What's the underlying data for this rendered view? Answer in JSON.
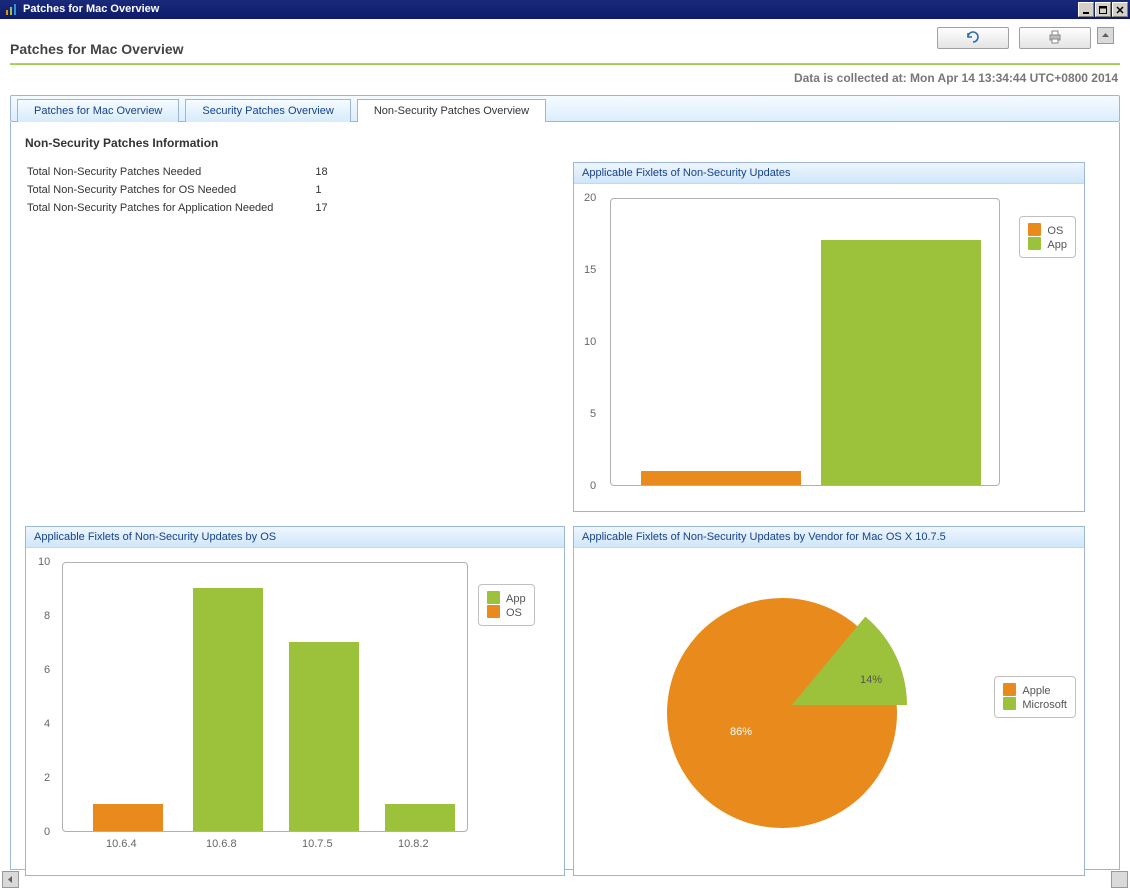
{
  "colors": {
    "orange": "#e98b1c",
    "green": "#9cc13b",
    "panel_blue": "#d0e6fb",
    "blue_text": "#15428b"
  },
  "window_title": "Patches for Mac Overview",
  "page_title": "Patches for Mac Overview",
  "data_collected_label": "Data is collected at: Mon Apr 14 13:34:44 UTC+0800 2014",
  "tabs": [
    {
      "label": "Patches for Mac Overview"
    },
    {
      "label": "Security Patches Overview"
    },
    {
      "label": "Non-Security Patches Overview"
    }
  ],
  "section_title": "Non-Security Patches Information",
  "info_rows": [
    {
      "label": "Total Non-Security Patches Needed",
      "value": "18"
    },
    {
      "label": "Total Non-Security Patches for OS Needed",
      "value": "1"
    },
    {
      "label": "Total Non-Security Patches for Application Needed",
      "value": "17"
    }
  ],
  "panel1": {
    "title": "Applicable Fixlets of Non-Security Updates",
    "legend": [
      {
        "name": "OS",
        "color": "#e98b1c"
      },
      {
        "name": "App",
        "color": "#9cc13b"
      }
    ]
  },
  "panel2": {
    "title": "Applicable Fixlets of Non-Security Updates by OS",
    "legend": [
      {
        "name": "App",
        "color": "#9cc13b"
      },
      {
        "name": "OS",
        "color": "#e98b1c"
      }
    ]
  },
  "panel3": {
    "title": "Applicable Fixlets of Non-Security Updates by Vendor for Mac OS X 10.7.5",
    "legend": [
      {
        "name": "Apple",
        "color": "#e98b1c"
      },
      {
        "name": "Microsoft",
        "color": "#9cc13b"
      }
    ],
    "slice1_label": "14%",
    "slice2_label": "86%"
  },
  "chart_data": [
    {
      "type": "bar",
      "title": "Applicable Fixlets of Non-Security Updates",
      "categories": [
        "",
        ""
      ],
      "series": [
        {
          "name": "OS",
          "values": [
            1,
            0
          ]
        },
        {
          "name": "App",
          "values": [
            0,
            17
          ]
        }
      ],
      "ylim": [
        0,
        20
      ],
      "yticks": [
        0,
        5,
        10,
        15,
        20
      ]
    },
    {
      "type": "bar",
      "title": "Applicable Fixlets of Non-Security Updates by OS",
      "categories": [
        "10.6.4",
        "10.6.8",
        "10.7.5",
        "10.8.2"
      ],
      "series": [
        {
          "name": "App",
          "values": [
            0,
            9,
            7,
            1
          ]
        },
        {
          "name": "OS",
          "values": [
            1,
            0,
            0,
            0
          ]
        }
      ],
      "ylim": [
        0,
        10
      ],
      "yticks": [
        0,
        2,
        4,
        6,
        8,
        10
      ]
    },
    {
      "type": "pie",
      "title": "Applicable Fixlets of Non-Security Updates by Vendor for Mac OS X 10.7.5",
      "series": [
        {
          "name": "Apple",
          "value": 86
        },
        {
          "name": "Microsoft",
          "value": 14
        }
      ]
    }
  ],
  "yticks1": {
    "t0": "0",
    "t1": "5",
    "t2": "10",
    "t3": "15",
    "t4": "20"
  },
  "yticks2": {
    "t0": "0",
    "t1": "2",
    "t2": "4",
    "t3": "6",
    "t4": "8",
    "t5": "10"
  },
  "xticks2": {
    "c0": "10.6.4",
    "c1": "10.6.8",
    "c2": "10.7.5",
    "c3": "10.8.2"
  }
}
